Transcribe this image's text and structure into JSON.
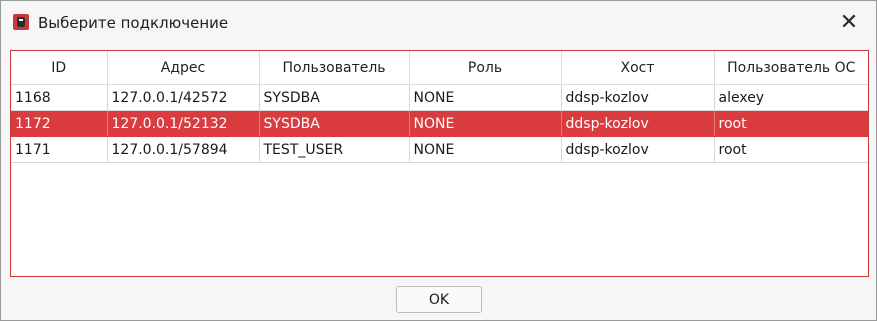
{
  "window": {
    "title": "Выберите подключение",
    "app_icon": "database-icon",
    "close_glyph": "✕"
  },
  "table": {
    "columns": [
      "ID",
      "Адрес",
      "Пользователь",
      "Роль",
      "Хост",
      "Пользователь ОС"
    ],
    "rows": [
      [
        "1168",
        "127.0.0.1/42572",
        "SYSDBA",
        "NONE",
        "ddsp-kozlov",
        "alexey"
      ],
      [
        "1172",
        "127.0.0.1/52132",
        "SYSDBA",
        "NONE",
        "ddsp-kozlov",
        "root"
      ],
      [
        "1171",
        "127.0.0.1/57894",
        "TEST_USER",
        "NONE",
        "ddsp-kozlov",
        "root"
      ]
    ],
    "selected_row": 1
  },
  "buttons": {
    "ok_label": "OK"
  },
  "colors": {
    "accent": "#da3b3e",
    "frame_border": "#c83a3a"
  }
}
